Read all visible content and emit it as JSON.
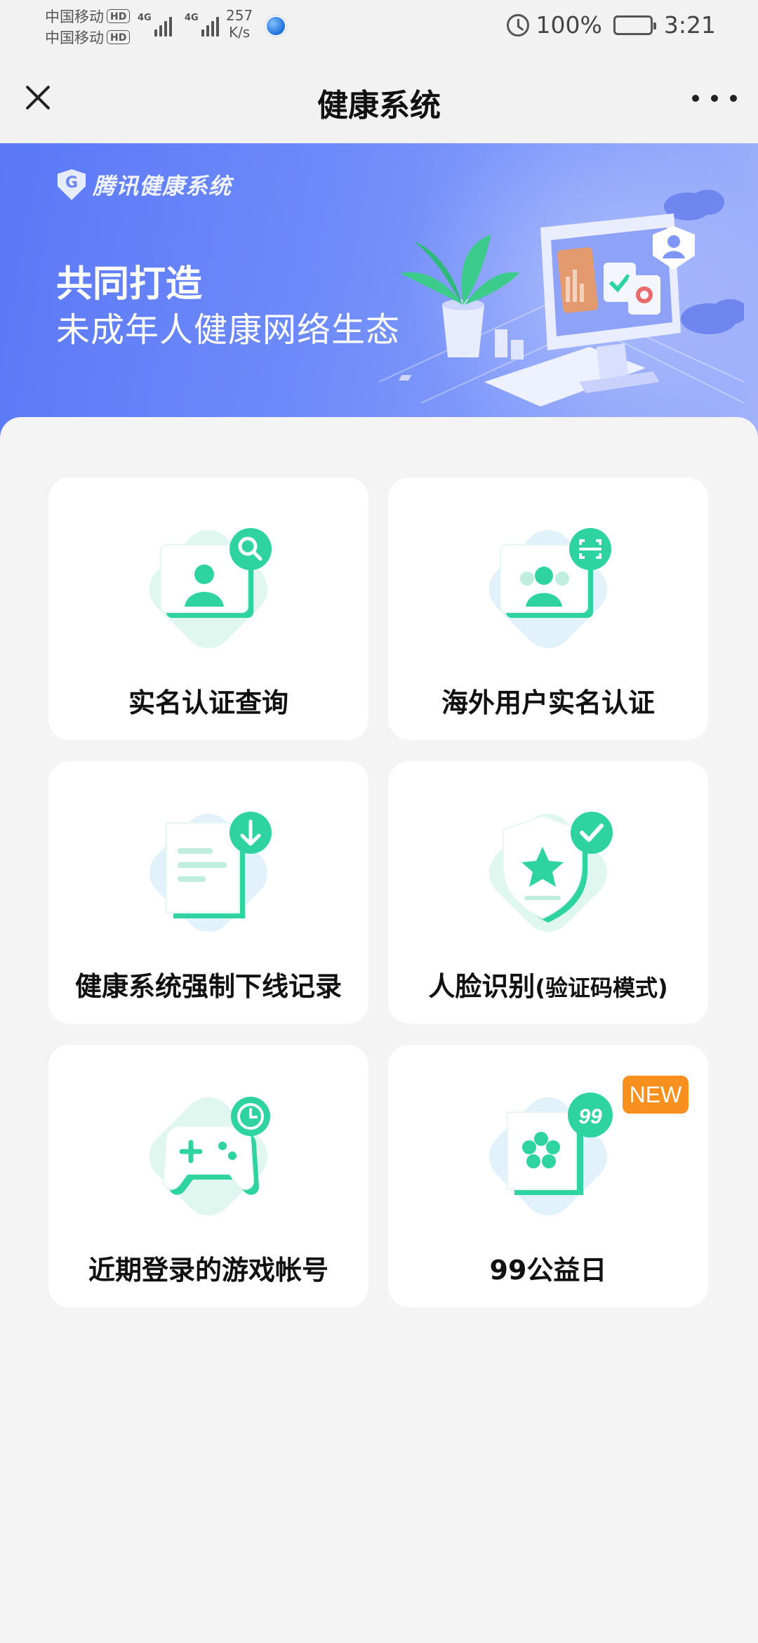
{
  "status_bar": {
    "carrier_1": "中国移动",
    "carrier_2": "中国移动",
    "hd_label": "HD",
    "network_type_1": "4G",
    "network_type_2": "4G",
    "speed_value": "257",
    "speed_unit": "K/s",
    "battery": "100%",
    "time": "3:21"
  },
  "nav": {
    "title": "健康系统"
  },
  "banner": {
    "logo_text": "腾讯健康系统",
    "headline": "共同打造",
    "subline": "未成年人健康网络生态"
  },
  "cards": [
    {
      "label": "实名认证查询",
      "icon": "id-search-icon"
    },
    {
      "label": "海外用户实名认证",
      "icon": "group-scan-icon"
    },
    {
      "label": "健康系统强制下线记录",
      "icon": "document-download-icon"
    },
    {
      "label_main": "人脸识别",
      "label_paren": "(验证码模式)",
      "icon": "shield-check-icon"
    },
    {
      "label": "近期登录的游戏帐号",
      "icon": "gamepad-clock-icon"
    },
    {
      "label": "99公益日",
      "icon": "charity-99-icon",
      "badge": "NEW",
      "badge_text": "99"
    }
  ],
  "colors": {
    "accent_green": "#2fd3a0",
    "banner_blue": "#5b78f6",
    "badge_orange": "#f7901e"
  }
}
